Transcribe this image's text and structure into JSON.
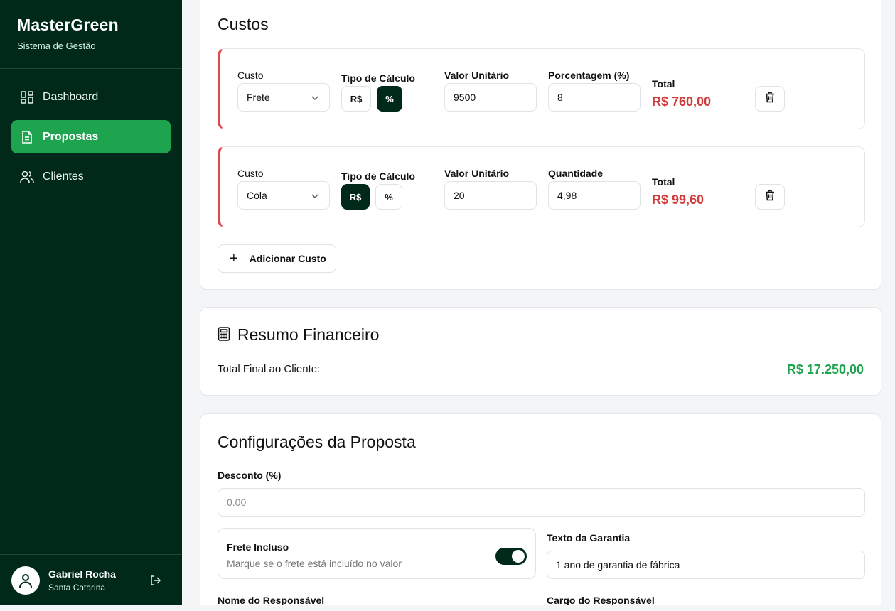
{
  "sidebar": {
    "brand": "MasterGreen",
    "subtitle": "Sistema de Gestão",
    "items": [
      {
        "label": "Dashboard",
        "icon": "dashboard-icon"
      },
      {
        "label": "Propostas",
        "icon": "document-icon",
        "active": true
      },
      {
        "label": "Clientes",
        "icon": "users-icon"
      }
    ],
    "user": {
      "name": "Gabriel Rocha",
      "location": "Santa Catarina"
    }
  },
  "costs": {
    "title": "Custos",
    "rows": [
      {
        "cost_label": "Custo",
        "cost_value": "Frete",
        "type_label": "Tipo de Cálculo",
        "type_options": [
          "R$",
          "%"
        ],
        "type_selected": "%",
        "unit_label": "Valor Unitário",
        "unit_value": "9500",
        "qty_label": "Porcentagem (%)",
        "qty_value": "8",
        "total_label": "Total",
        "total_value": "R$ 760,00"
      },
      {
        "cost_label": "Custo",
        "cost_value": "Cola",
        "type_label": "Tipo de Cálculo",
        "type_options": [
          "R$",
          "%"
        ],
        "type_selected": "R$",
        "unit_label": "Valor Unitário",
        "unit_value": "20",
        "qty_label": "Quantidade",
        "qty_value": "4,98",
        "total_label": "Total",
        "total_value": "R$ 99,60"
      }
    ],
    "add_label": "Adicionar Custo"
  },
  "summary": {
    "title": "Resumo Financeiro",
    "total_label": "Total Final ao Cliente:",
    "total_value": "R$ 17.250,00"
  },
  "config": {
    "title": "Configurações da Proposta",
    "discount_label": "Desconto (%)",
    "discount_placeholder": "0.00",
    "freight_title": "Frete Incluso",
    "freight_desc": "Marque se o frete está incluído no valor",
    "freight_on": true,
    "warranty_label": "Texto da Garantia",
    "warranty_value": "1 ano de garantia de fábrica",
    "resp_name_label": "Nome do Responsável",
    "resp_role_label": "Cargo do Responsável"
  },
  "colors": {
    "sidebar_bg": "#00291a",
    "active": "#1ea34f",
    "negative": "#d23b3b",
    "positive": "#1ea34f"
  }
}
